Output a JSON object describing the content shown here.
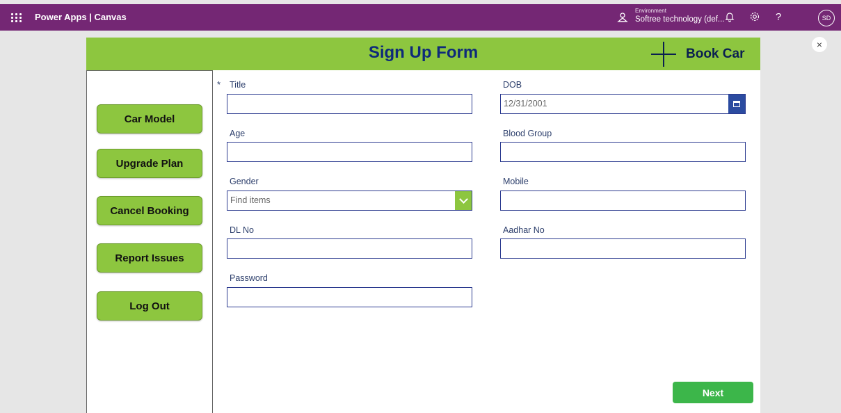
{
  "header": {
    "app_title": "Power Apps | Canvas",
    "environment_label": "Environment",
    "environment_name": "Softree technology (def...",
    "avatar_initials": "SD",
    "help_glyph": "?"
  },
  "close_glyph": "×",
  "form": {
    "banner_title": "Sign Up Form",
    "book_car_label": "Book Car",
    "next_label": "Next",
    "required_marker": "*"
  },
  "sidebar": {
    "items": [
      {
        "label": "Car Model"
      },
      {
        "label": "Upgrade Plan"
      },
      {
        "label": "Cancel Booking"
      },
      {
        "label": "Report Issues"
      },
      {
        "label": "Log Out"
      }
    ]
  },
  "fields": {
    "title": {
      "label": "Title",
      "value": ""
    },
    "dob": {
      "label": "DOB",
      "value": "12/31/2001"
    },
    "age": {
      "label": "Age",
      "value": ""
    },
    "blood_group": {
      "label": "Blood Group",
      "value": ""
    },
    "gender": {
      "label": "Gender",
      "placeholder": "Find items"
    },
    "mobile": {
      "label": "Mobile",
      "value": ""
    },
    "dl_no": {
      "label": "DL No",
      "value": ""
    },
    "aadhar_no": {
      "label": "Aadhar No",
      "value": ""
    },
    "password": {
      "label": "Password",
      "value": ""
    }
  },
  "colors": {
    "header_purple": "#742774",
    "banner_green": "#8dc63f",
    "title_navy": "#0e2a7a",
    "next_green": "#3cb64a",
    "input_border": "#2b3a8f"
  },
  "icons": [
    "waffle-icon",
    "environment-icon",
    "bell-icon",
    "gear-icon",
    "help-icon",
    "close-icon",
    "plus-icon",
    "calendar-icon",
    "chevron-down-icon"
  ]
}
